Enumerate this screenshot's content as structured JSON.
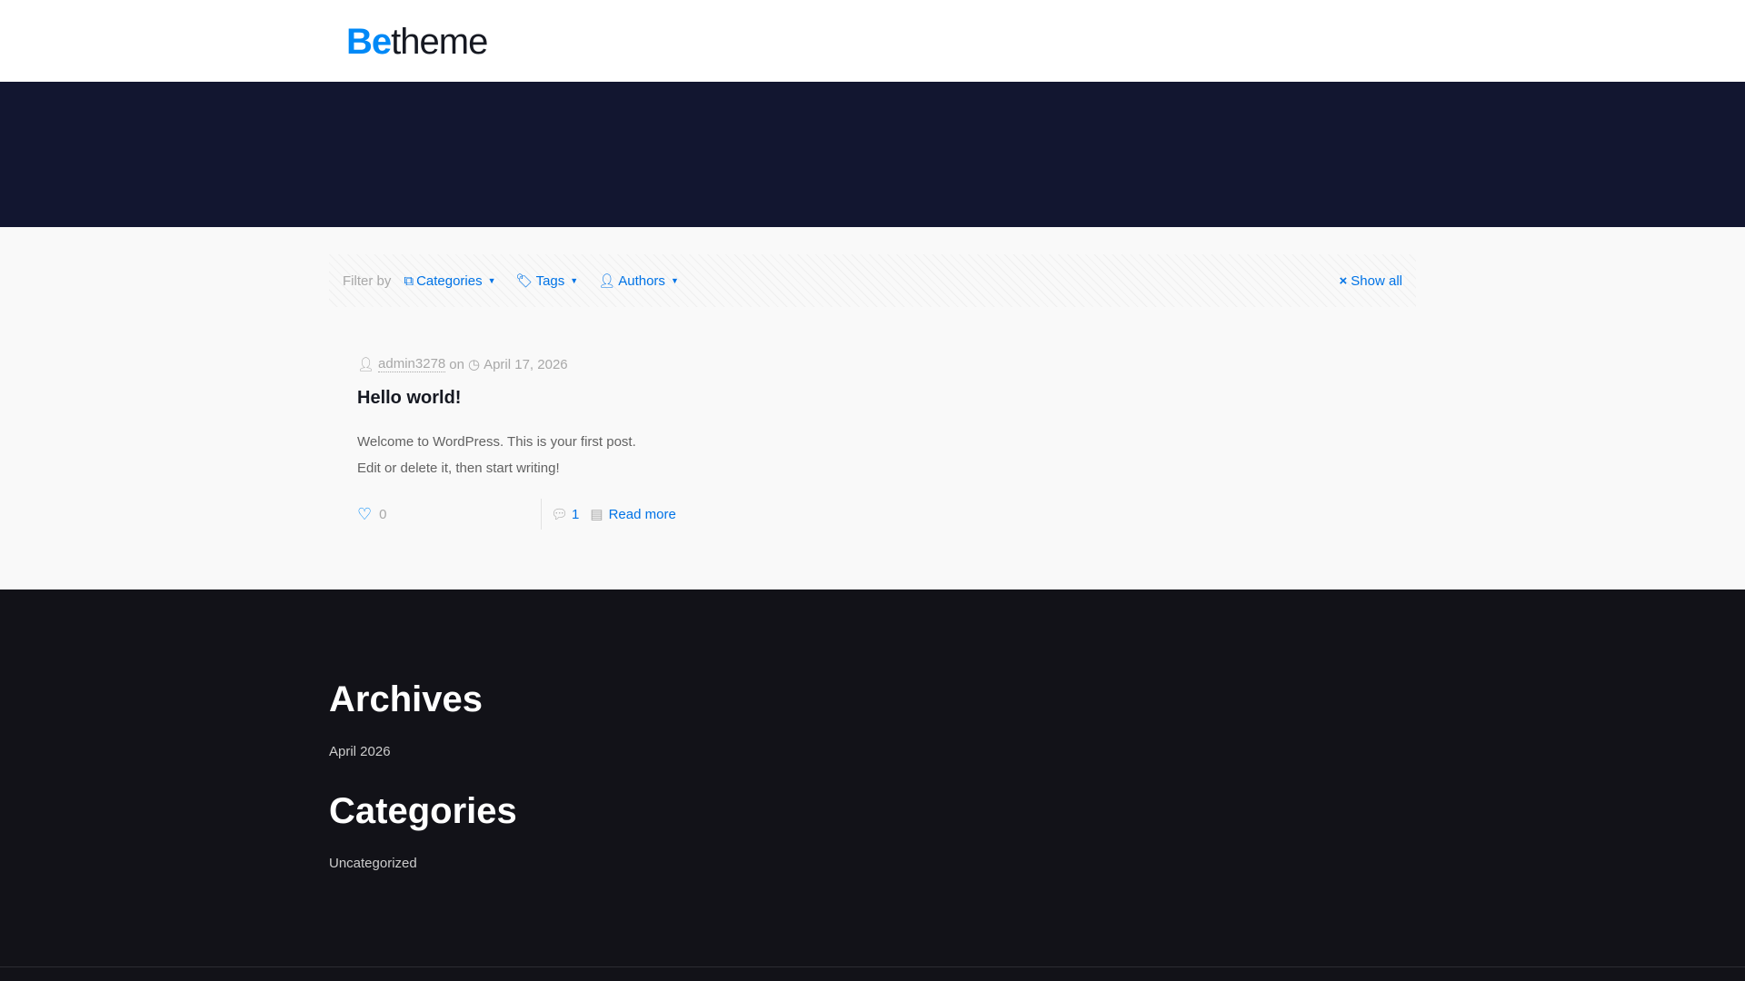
{
  "logo": {
    "be": "Be",
    "theme": "theme",
    "brand_color": "#0089f7"
  },
  "filter": {
    "label": "Filter by",
    "categories": "Categories",
    "tags": "Tags",
    "authors": "Authors",
    "show_all": "Show all"
  },
  "post": {
    "author": "admin3278",
    "on": "on",
    "date": "April 17, 2026",
    "title": "Hello world!",
    "excerpt": [
      "Welcome to WordPress. This is your first post.",
      "Edit or delete it, then start writing!"
    ],
    "likes": "0",
    "comments": "1",
    "read_more": "Read more"
  },
  "footer": {
    "archives_title": "Archives",
    "archives": [
      "April 2026"
    ],
    "categories_title": "Categories",
    "categories": [
      "Uncategorized"
    ]
  }
}
